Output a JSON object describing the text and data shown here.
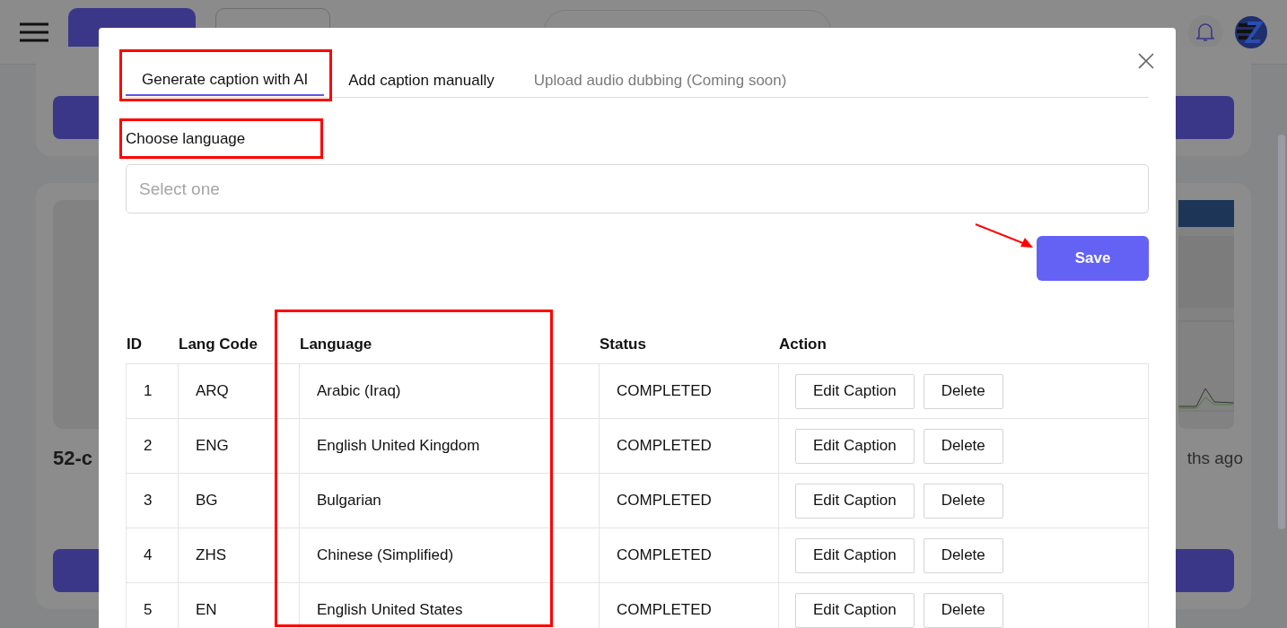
{
  "background": {
    "card_title": "52-c",
    "card_time": "ths ago"
  },
  "modal": {
    "tabs": [
      {
        "label": "Generate caption with AI",
        "selected": true,
        "disabled": false
      },
      {
        "label": "Add caption manually",
        "selected": false,
        "disabled": false
      },
      {
        "label": "Upload audio dubbing (Coming soon)",
        "selected": false,
        "disabled": true
      }
    ],
    "language_label": "Choose language",
    "language_select": {
      "placeholder": "Select one"
    },
    "save_button": "Save",
    "table": {
      "columns": [
        "ID",
        "Lang Code",
        "Language",
        "Status",
        "Action"
      ],
      "rows": [
        {
          "id": "1",
          "lang_code": "ARQ",
          "language": "Arabic (Iraq)",
          "status": "COMPLETED",
          "actions": [
            "Edit Caption",
            "Delete"
          ]
        },
        {
          "id": "2",
          "lang_code": "ENG",
          "language": "English United Kingdom",
          "status": "COMPLETED",
          "actions": [
            "Edit Caption",
            "Delete"
          ]
        },
        {
          "id": "3",
          "lang_code": "BG",
          "language": "Bulgarian",
          "status": "COMPLETED",
          "actions": [
            "Edit Caption",
            "Delete"
          ]
        },
        {
          "id": "4",
          "lang_code": "ZHS",
          "language": "Chinese (Simplified)",
          "status": "COMPLETED",
          "actions": [
            "Edit Caption",
            "Delete"
          ]
        },
        {
          "id": "5",
          "lang_code": "EN",
          "language": "English United States",
          "status": "COMPLETED",
          "actions": [
            "Edit Caption",
            "Delete"
          ]
        }
      ]
    }
  }
}
